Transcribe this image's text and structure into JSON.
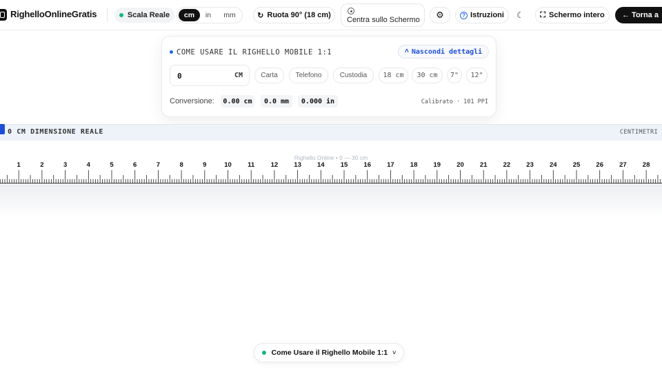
{
  "header": {
    "brand": "RighelloOnlineGratis",
    "scale_label": "Scala Reale",
    "units": [
      "cm",
      "in",
      "mm"
    ],
    "active_unit": "cm",
    "rotate_label": "Ruota 90° (18 cm)",
    "center_label": "Centra sullo Schermo",
    "instructions_label": "Istruzioni",
    "fullscreen_label": "Schermo intero",
    "back_label": "← Torna a"
  },
  "card": {
    "title": "COME USARE IL RIGHELLO MOBILE 1:1",
    "toggle_label": "Nascondi dettagli",
    "length_value": "0",
    "length_unit": "CM",
    "presets": [
      "Carta",
      "Telefono",
      "Custodia",
      "18 cm",
      "30 cm",
      "7\"",
      "12\""
    ],
    "conversion_label": "Conversione:",
    "conversions": [
      "0.00 cm",
      "0.0 mm",
      "0.000 in"
    ],
    "calibration": "Calibrato · 101 PPI"
  },
  "ruler": {
    "left_label": "0 CM DIMENSIONE REALE",
    "right_label": "CENTIMETRI",
    "watermark": "Righello Online • 0 — 30 cm",
    "cm_labels": [
      "1",
      "2",
      "3",
      "4",
      "5",
      "6",
      "7",
      "8",
      "9",
      "10",
      "11",
      "12",
      "13",
      "14",
      "15",
      "16",
      "17",
      "18",
      "19",
      "20",
      "21",
      "22",
      "23",
      "24",
      "25",
      "26",
      "27",
      "28"
    ],
    "ppi": 101
  },
  "footer": {
    "guide_label": "Come Usare il Righello Mobile 1:1"
  },
  "colors": {
    "accent": "#2563eb",
    "status": "#10b981",
    "dark": "#111111"
  },
  "icons": [
    "ruler-logo-icon",
    "rotate-icon",
    "target-icon",
    "gear-icon",
    "help-icon",
    "moon-icon",
    "fullscreen-icon",
    "chevron-up-icon",
    "chevron-down-icon"
  ]
}
